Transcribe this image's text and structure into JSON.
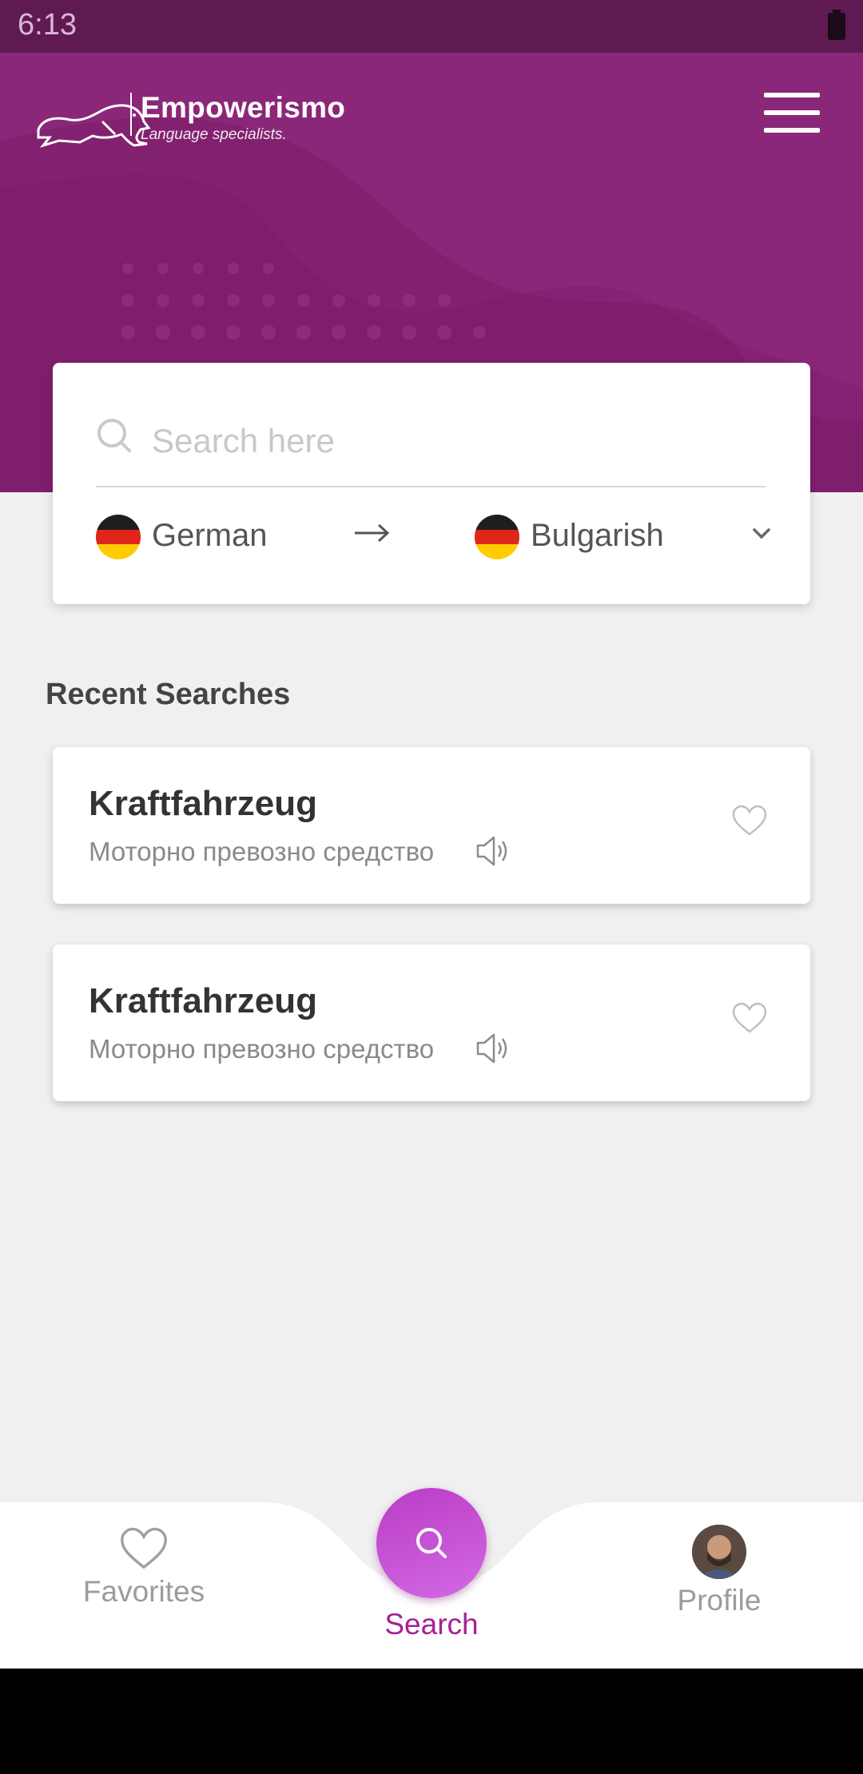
{
  "status": {
    "time": "6:13"
  },
  "header": {
    "brand_name": "Empowerismo",
    "brand_tagline": "Language specialists."
  },
  "search": {
    "placeholder": "Search here",
    "value": "",
    "source_language": "German",
    "target_language": "Bulgarish"
  },
  "recent": {
    "title": "Recent Searches",
    "items": [
      {
        "word": "Kraftfahrzeug",
        "translation": "Моторно превозно средство"
      },
      {
        "word": "Kraftfahrzeug",
        "translation": "Моторно превозно средство"
      }
    ]
  },
  "nav": {
    "favorites": "Favorites",
    "search": "Search",
    "profile": "Profile"
  },
  "colors": {
    "brand_purple": "#82216f",
    "accent": "#a62195",
    "fab": "#c450d4"
  }
}
